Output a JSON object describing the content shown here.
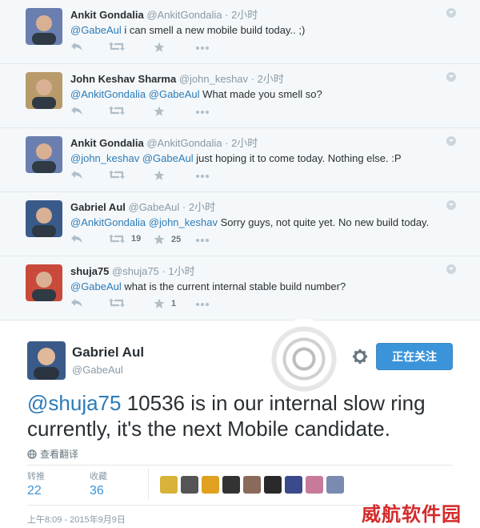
{
  "replies": [
    {
      "name": "Ankit Gondalia",
      "handle": "@AnkitGondalia",
      "time": "2小时",
      "mentions": [
        "@GabeAul"
      ],
      "text": " i can smell a new mobile build today.. ;)",
      "retweets": "",
      "likes": "",
      "avatar_color": "#6a7fb0"
    },
    {
      "name": "John Keshav Sharma",
      "handle": "@john_keshav",
      "time": "2小时",
      "mentions": [
        "@AnkitGondalia",
        "@GabeAul"
      ],
      "text": " What made you smell so?",
      "retweets": "",
      "likes": "",
      "avatar_color": "#b99a6a"
    },
    {
      "name": "Ankit Gondalia",
      "handle": "@AnkitGondalia",
      "time": "2小时",
      "mentions": [
        "@john_keshav",
        "@GabeAul"
      ],
      "text": " just hoping it to come today. Nothing else. :P",
      "retweets": "",
      "likes": "",
      "avatar_color": "#6a7fb0"
    },
    {
      "name": "Gabriel Aul",
      "handle": "@GabeAul",
      "time": "2小时",
      "mentions": [
        "@AnkitGondalia",
        "@john_keshav"
      ],
      "text": " Sorry guys, not quite yet. No new build today.",
      "retweets": "19",
      "likes": "25",
      "avatar_color": "#3a5a8a"
    },
    {
      "name": "shuja75",
      "handle": "@shuja75",
      "time": "1小时",
      "mentions": [
        "@GabeAul"
      ],
      "text": " what is the current internal stable build number?",
      "retweets": "",
      "likes": "1",
      "avatar_color": "#c94a3a"
    }
  ],
  "main_tweet": {
    "name": "Gabriel Aul",
    "handle": "@GabeAul",
    "follow_label": "正在关注",
    "mention": "@shuja75",
    "text": " 10536 is in our internal slow ring currently, it's the next Mobile candidate.",
    "translate_label": "查看翻译",
    "retweets_label": "转推",
    "retweets": "22",
    "likes_label": "收藏",
    "likes": "36",
    "timestamp": "上午8:09 - 2015年9月9日",
    "avatar_color": "#3a5a8a"
  },
  "liker_avatar_colors": [
    "#d9b23a",
    "#555555",
    "#e0a020",
    "#333333",
    "#8a6a5a",
    "#2a2a2a",
    "#3a4a8a",
    "#c87a9a",
    "#7a8ab0"
  ],
  "watermark": "威航软件园",
  "colors": {
    "link": "#2b7bb9",
    "follow_button": "#3b94d9",
    "reply_bg": "#f5f8fa"
  }
}
